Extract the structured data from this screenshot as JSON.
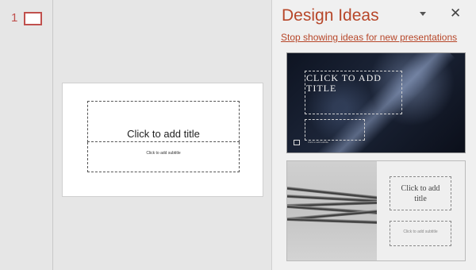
{
  "thumbnails": {
    "slide_number": "1"
  },
  "slide": {
    "title_placeholder": "Click to add title",
    "subtitle_placeholder": "Click to add subtitle"
  },
  "design_ideas": {
    "title": "Design Ideas",
    "stop_link": "Stop showing ideas for new presentations",
    "close_glyph": "✕",
    "cards": [
      {
        "title_placeholder": "CLICK TO ADD TITLE",
        "subtitle_placeholder": "Click to add subtitle",
        "theme": "dark snowflake"
      },
      {
        "title_placeholder": "Click to add title",
        "subtitle_placeholder": "Click to add subtitle",
        "theme": "twisted rope"
      }
    ]
  },
  "colors": {
    "accent": "#b7472a",
    "thumb_accent": "#c0504d",
    "background": "#e6e6e6",
    "pane": "#f0f0f0"
  }
}
